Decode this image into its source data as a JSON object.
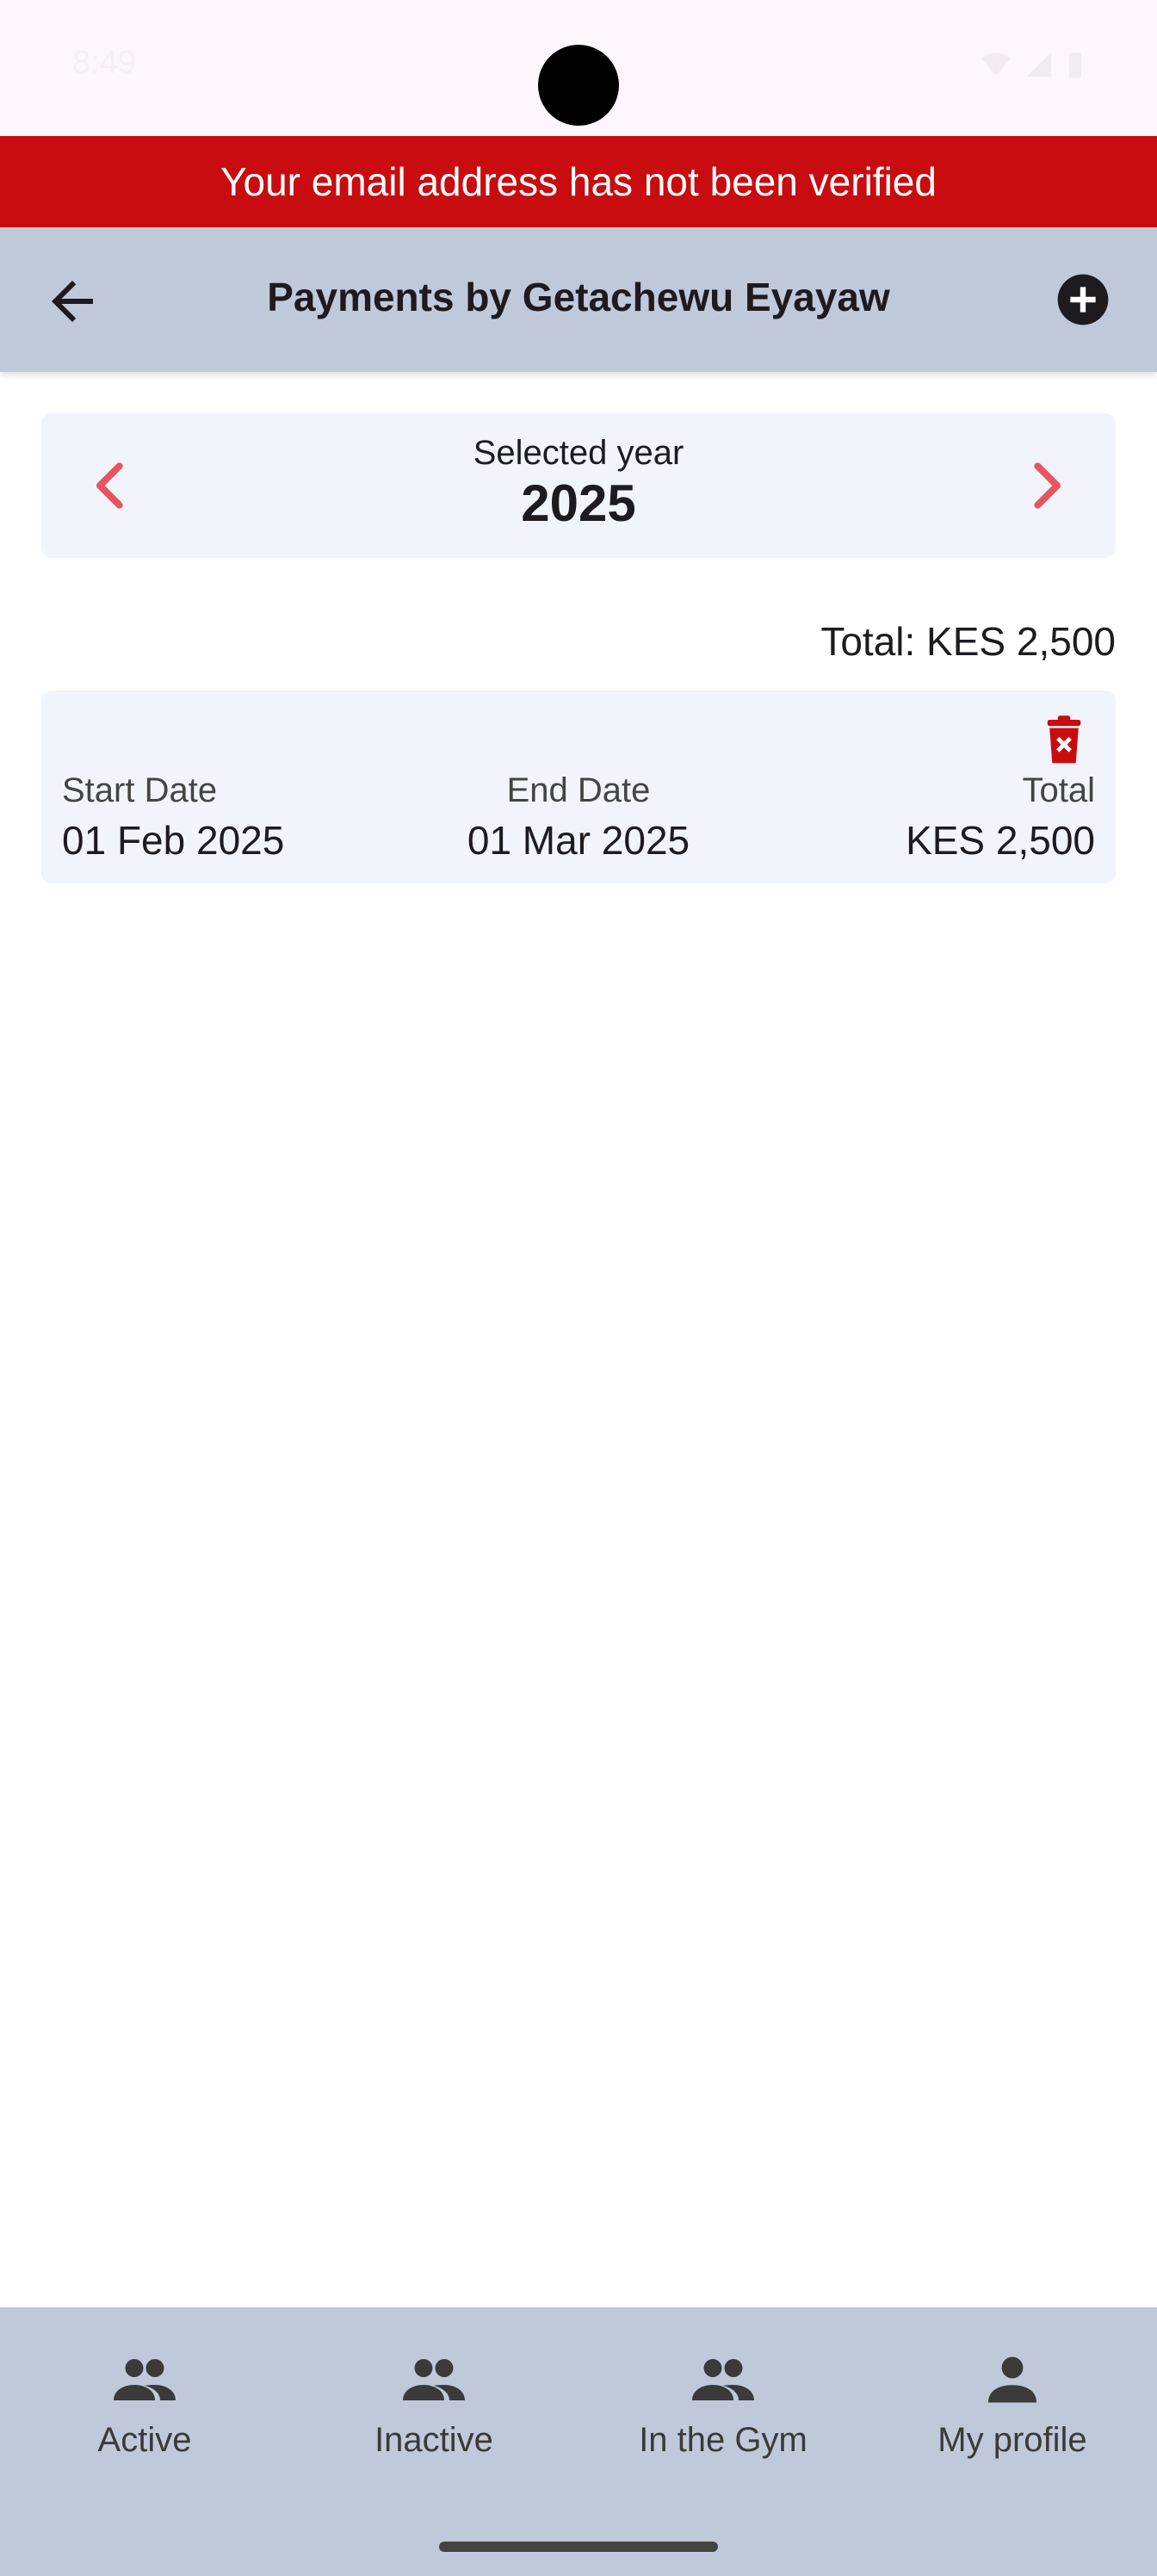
{
  "status_bar": {
    "time": "8:49"
  },
  "banner": {
    "text": "Your email address has not been verified"
  },
  "app_bar": {
    "title": "Payments by Getachewu Eyayaw"
  },
  "year_selector": {
    "label": "Selected year",
    "year": "2025"
  },
  "summary": {
    "total": "Total: KES 2,500"
  },
  "payments": [
    {
      "start_label": "Start Date",
      "start_value": "01 Feb 2025",
      "end_label": "End Date",
      "end_value": "01 Mar 2025",
      "total_label": "Total",
      "total_value": "KES 2,500"
    }
  ],
  "bottom_nav": {
    "items": [
      {
        "label": "Active",
        "icon": "group-icon"
      },
      {
        "label": "Inactive",
        "icon": "group-icon"
      },
      {
        "label": "In the Gym",
        "icon": "group-icon"
      },
      {
        "label": "My profile",
        "icon": "person-icon"
      }
    ]
  },
  "colors": {
    "banner": "#c80c0f",
    "app_bar": "#c0c9da",
    "card": "#f1f4fb",
    "chevron": "#e5565f",
    "delete": "#c80c0f"
  }
}
